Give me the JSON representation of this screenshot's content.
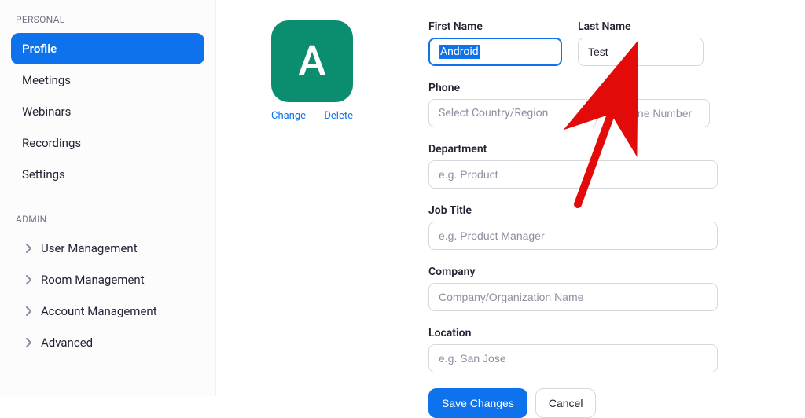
{
  "sidebar": {
    "personal_label": "PERSONAL",
    "admin_label": "ADMIN",
    "personal_items": [
      {
        "label": "Profile",
        "active": true
      },
      {
        "label": "Meetings",
        "active": false
      },
      {
        "label": "Webinars",
        "active": false
      },
      {
        "label": "Recordings",
        "active": false
      },
      {
        "label": "Settings",
        "active": false
      }
    ],
    "admin_items": [
      {
        "label": "User Management"
      },
      {
        "label": "Room Management"
      },
      {
        "label": "Account Management"
      },
      {
        "label": "Advanced"
      }
    ]
  },
  "avatar": {
    "initial": "A",
    "change_label": "Change",
    "delete_label": "Delete"
  },
  "form": {
    "first_name_label": "First Name",
    "first_name_value": "Android",
    "last_name_label": "Last Name",
    "last_name_value": "Test",
    "phone_label": "Phone",
    "country_placeholder": "Select Country/Region",
    "phone_placeholder": "Phone Number",
    "department_label": "Department",
    "department_placeholder": "e.g. Product",
    "jobtitle_label": "Job Title",
    "jobtitle_placeholder": "e.g. Product Manager",
    "company_label": "Company",
    "company_placeholder": "Company/Organization Name",
    "location_label": "Location",
    "location_placeholder": "e.g. San Jose",
    "save_label": "Save Changes",
    "cancel_label": "Cancel"
  },
  "colors": {
    "accent": "#0e72ed",
    "avatar_bg": "#0b8e6f",
    "arrow": "#e30a0a"
  }
}
